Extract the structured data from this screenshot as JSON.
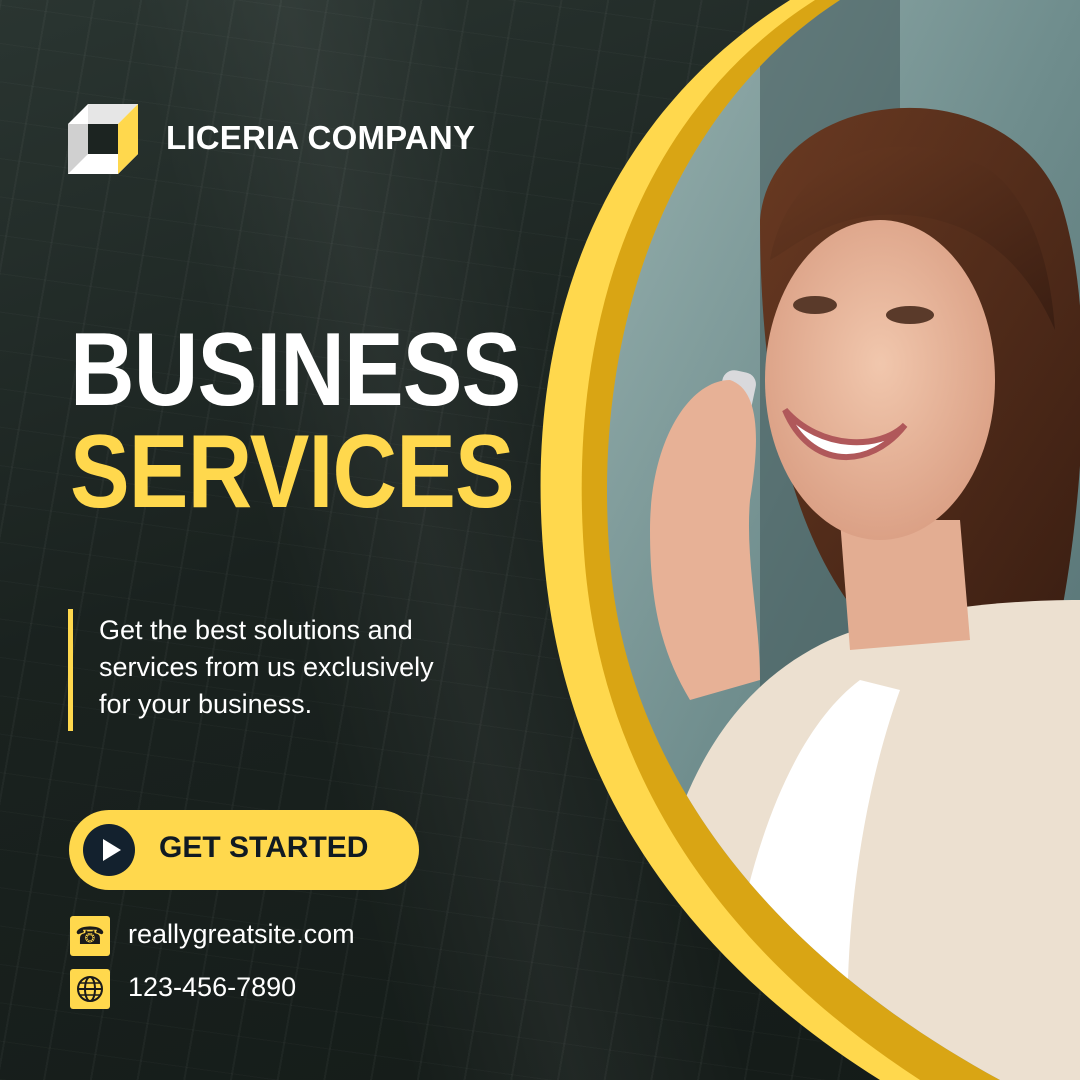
{
  "brand": {
    "name": "LICERIA COMPANY",
    "logo_icon": "folded-square-logo-icon"
  },
  "headline": {
    "line1": "BUSINESS",
    "line2": "SERVICES"
  },
  "description": {
    "lines": [
      "Get the best solutions and",
      "services from us exclusively",
      "for your business."
    ]
  },
  "cta": {
    "label": "GET STARTED",
    "icon": "play-icon"
  },
  "contact": {
    "website": "reallygreatsite.com",
    "website_icon": "phone-icon",
    "phone": "123-456-7890",
    "phone_icon": "globe-icon"
  },
  "colors": {
    "accent": "#ffd84d",
    "accent_dark": "#d9a514",
    "background": "#1c2421",
    "cta_icon_bg": "#13212e"
  }
}
